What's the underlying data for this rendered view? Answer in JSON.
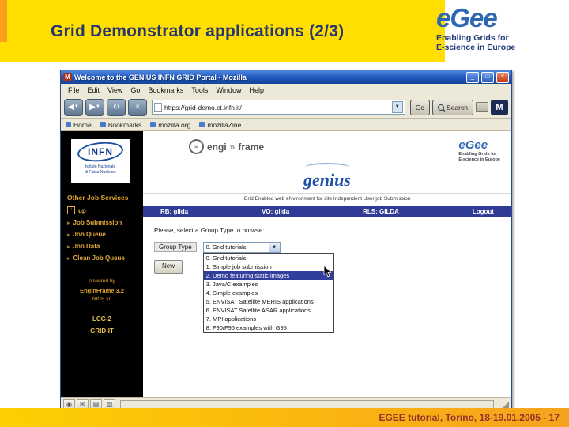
{
  "slide": {
    "title": "Grid Demonstrator applications (2/3)",
    "footer": "EGEE tutorial, Torino, 18-19.01.2005  - 17"
  },
  "egee_header_logo": {
    "brand": "eGee",
    "tagline_line1": "Enabling Grids for",
    "tagline_line2": "E-science in Europe"
  },
  "browser": {
    "window_title": "Welcome to the GENIUS INFN GRID Portal - Mozilla",
    "menu_items": [
      "File",
      "Edit",
      "View",
      "Go",
      "Bookmarks",
      "Tools",
      "Window",
      "Help"
    ],
    "url_value": "https://grid-demo.ct.infn.it/",
    "go_button": "Go",
    "search_button": "Search",
    "bookmark_items": [
      "Home",
      "Bookmarks",
      "mozilla.org",
      "mozillaZine"
    ]
  },
  "sidebar": {
    "logo_text": "INFN",
    "logo_sub1": "Istituto Nazionale",
    "logo_sub2": "di Fisica Nucleare",
    "section_title": "Other Job Services",
    "items": [
      "up",
      "Job Submission",
      "Job Queue",
      "Job Data",
      "Clean Job Queue"
    ],
    "powered_by": "powered by",
    "powered_name": "EnginFrame 3.2",
    "powered_org": "NICE srl",
    "links": [
      "LCG-2",
      "GRID-IT"
    ]
  },
  "portal": {
    "ef_left": "engi",
    "ef_right": "frame",
    "egee_brand": "eGee",
    "egee_tag1": "Enabling Grids for",
    "egee_tag2": "E-science in Europe",
    "genius_brand": "genius",
    "tagline": "Grid Enabled web eNvironment for site Independent User job Submission",
    "infobar": {
      "rb": "RB: gilda",
      "vo": "VO: gilda",
      "rls": "RLS: GILDA",
      "logout": "Logout"
    },
    "prompt": "Please, select a Group Type to browse:",
    "group_type_label": "Group Type",
    "combo_value": "0. Grid tutorials",
    "new_button": "New",
    "dropdown": {
      "selected_index": 2,
      "items": [
        "0. Grid tutorials",
        "1. Simple job submission",
        "2. Demo featuring static images",
        "3. Java/C examples",
        "4. Simple examples",
        "5. ENVISAT Satellite MERIS applications",
        "6. ENVISAT Satellite ASAR applications",
        "7. MPI applications",
        "8. F90/F95 examples with G95"
      ]
    }
  },
  "icons": {
    "window_badge": "M",
    "minimize": "_",
    "maximize": "□",
    "close": "×",
    "back": "◀",
    "forward": "▶",
    "reload": "↻",
    "stop": "×",
    "caret": "▼",
    "bullet": "▸",
    "up_arrow": "↑",
    "ef_symbol": "≡",
    "ef_arrow": "»",
    "moz_badge": "M",
    "grip": "◢",
    "component_icons": [
      "◉",
      "✉",
      "▤",
      "▥"
    ]
  },
  "colors": {
    "slide_yellow": "#FFDE00",
    "slide_orange": "#F9A11B",
    "title_navy": "#26366F",
    "footer_text": "#93312D",
    "portal_navy": "#2F3B94",
    "selection_blue": "#323E9C",
    "sidebar_gold": "#DFA32F"
  }
}
